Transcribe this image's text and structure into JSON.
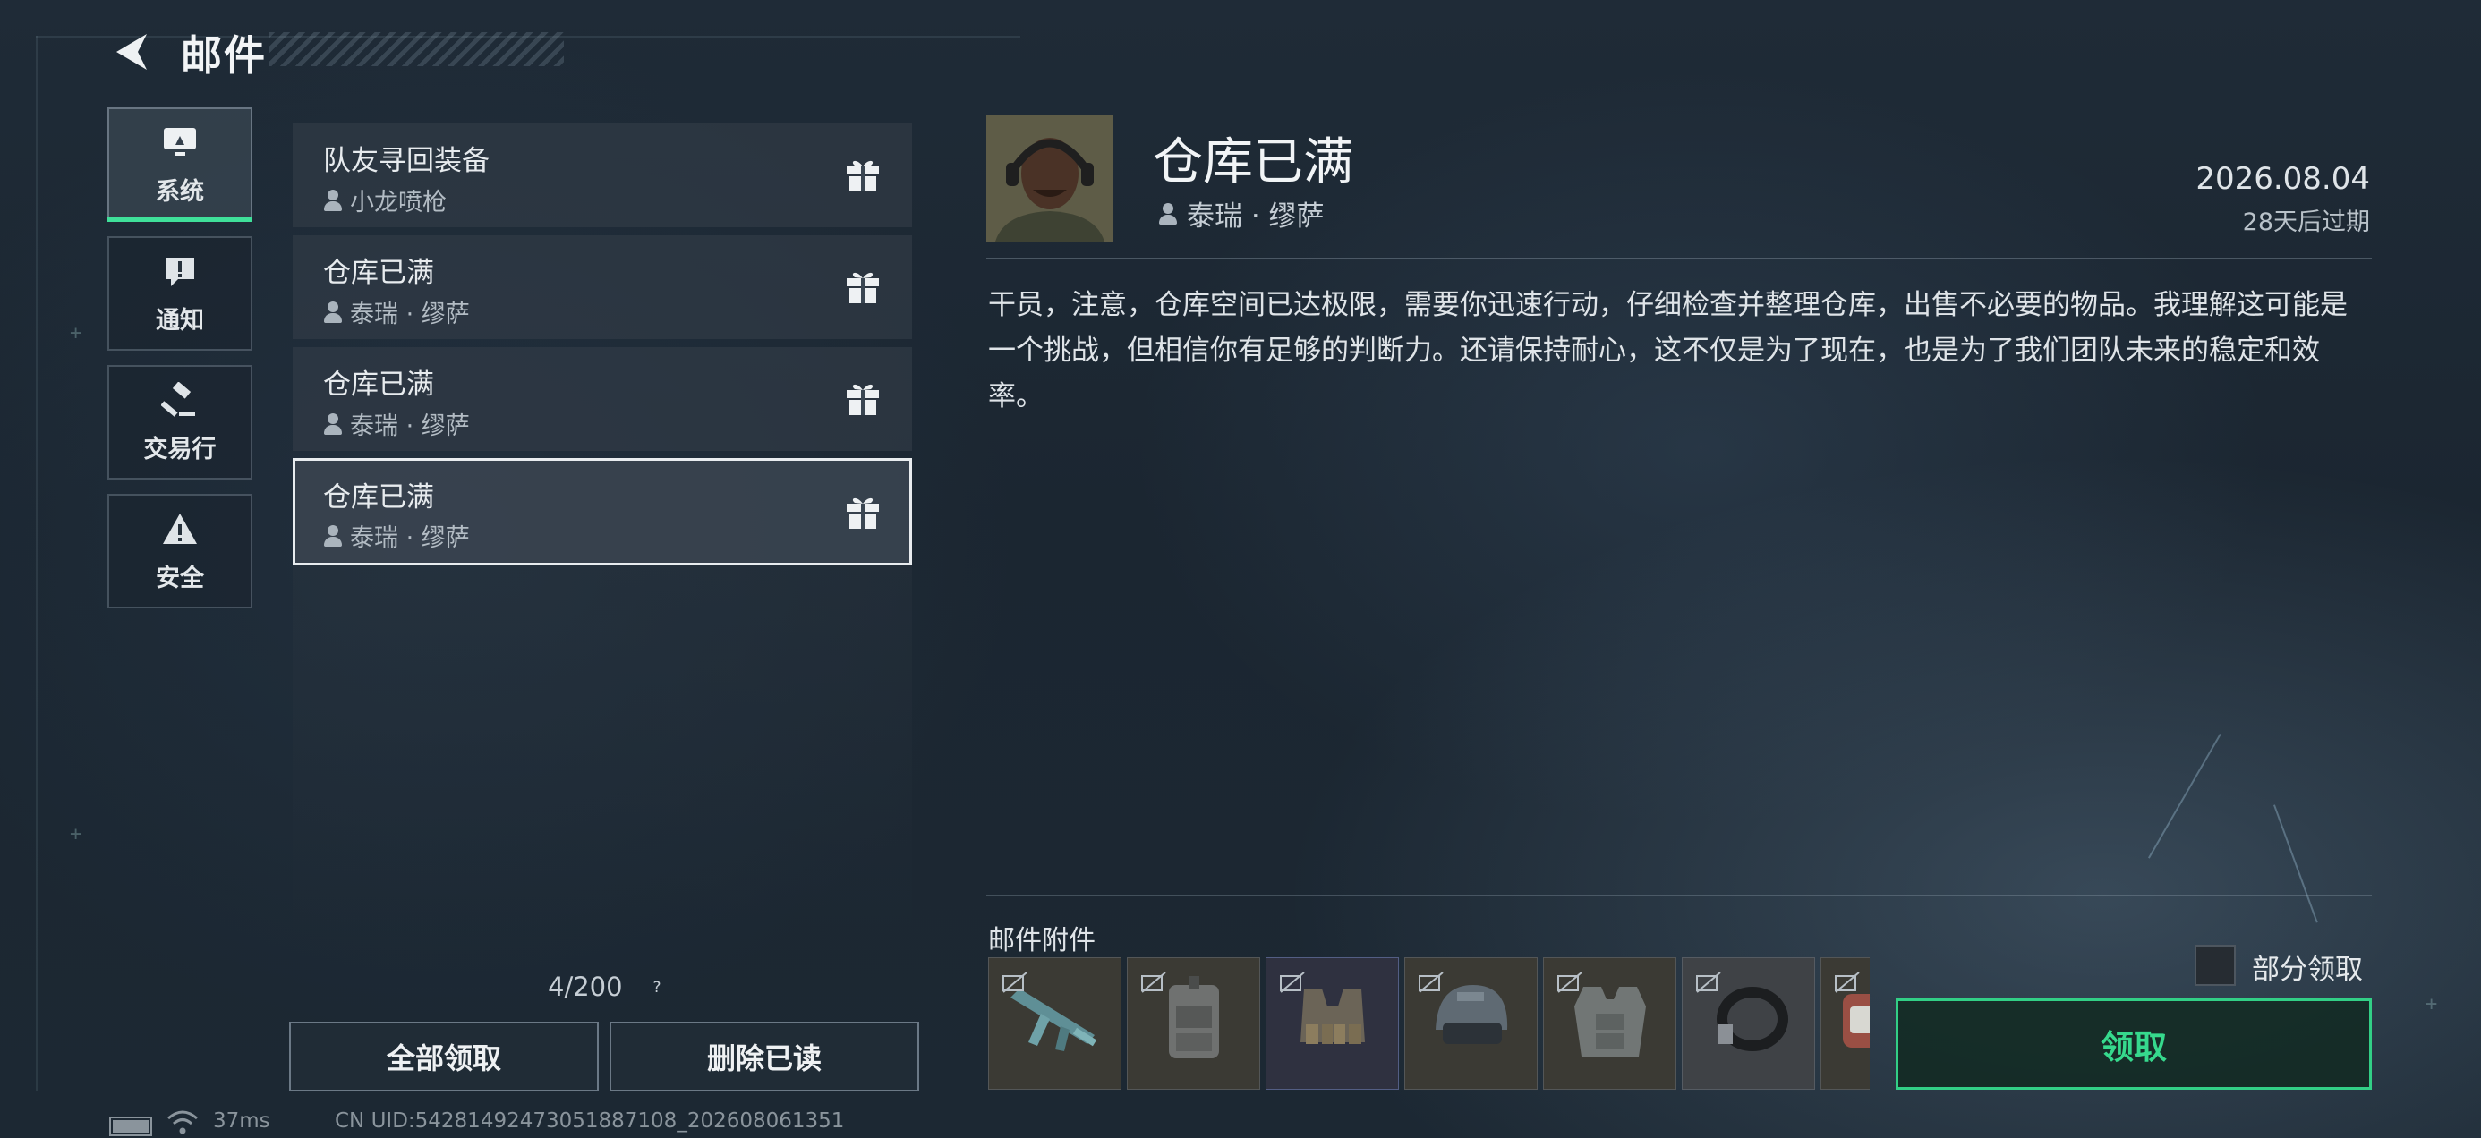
{
  "header": {
    "title": "邮件"
  },
  "tabs": [
    {
      "label": "系统",
      "icon": "monitor-icon",
      "active": true
    },
    {
      "label": "通知",
      "icon": "exclamation-icon",
      "active": false
    },
    {
      "label": "交易行",
      "icon": "gavel-icon",
      "active": false
    },
    {
      "label": "安全",
      "icon": "warning-icon",
      "active": false
    }
  ],
  "mail_list": [
    {
      "title": "队友寻回装备",
      "sender": "小龙喷枪",
      "icon": "gift-icon"
    },
    {
      "title": "仓库已满",
      "sender": "泰瑞 · 缪萨",
      "icon": "gift-icon"
    },
    {
      "title": "仓库已满",
      "sender": "泰瑞 · 缪萨",
      "icon": "gift-icon"
    },
    {
      "title": "仓库已满",
      "sender": "泰瑞 · 缪萨",
      "icon": "gift-icon",
      "selected": true
    }
  ],
  "list_footer": {
    "count": "4/200",
    "help": "?",
    "claim_all": "全部领取",
    "delete_read": "删除已读"
  },
  "status_bar": {
    "ping": "37ms",
    "uid": "CN UID:54281492473051887108_202608061351"
  },
  "detail": {
    "title": "仓库已满",
    "sender": "泰瑞 · 缪萨",
    "date": "2026.08.04",
    "expire": "28天后过期",
    "body": "干员，注意，仓库空间已达极限，需要你迅速行动，仔细检查并整理仓库，出售不必要的物品。我理解这可能是一个挑战，但相信你有足够的判断力。还请保持耐心，这不仅是为了现在，也是为了我们团队未来的稳定和效率。",
    "attachments_label": "邮件附件",
    "attachments": [
      {
        "name": "rifle-item-icon",
        "rarity_color": "#3b3a34"
      },
      {
        "name": "backpack-item-icon",
        "rarity_color": "#3b3a34"
      },
      {
        "name": "chest-rig-item-icon",
        "rarity_color": "#2f3140"
      },
      {
        "name": "helmet-item-icon",
        "rarity_color": "#3b3a34"
      },
      {
        "name": "body-armor-item-icon",
        "rarity_color": "#3b3a34"
      },
      {
        "name": "strap-item-icon",
        "rarity_color": "#3f4246"
      },
      {
        "name": "case-item-icon",
        "rarity_color": "#3b3a34"
      }
    ],
    "partial_claim_label": "部分领取",
    "claim_label": "领取"
  },
  "colors": {
    "accent_green": "#36d98d",
    "background": "#1c2833",
    "selected_border": "#e8ecef"
  }
}
